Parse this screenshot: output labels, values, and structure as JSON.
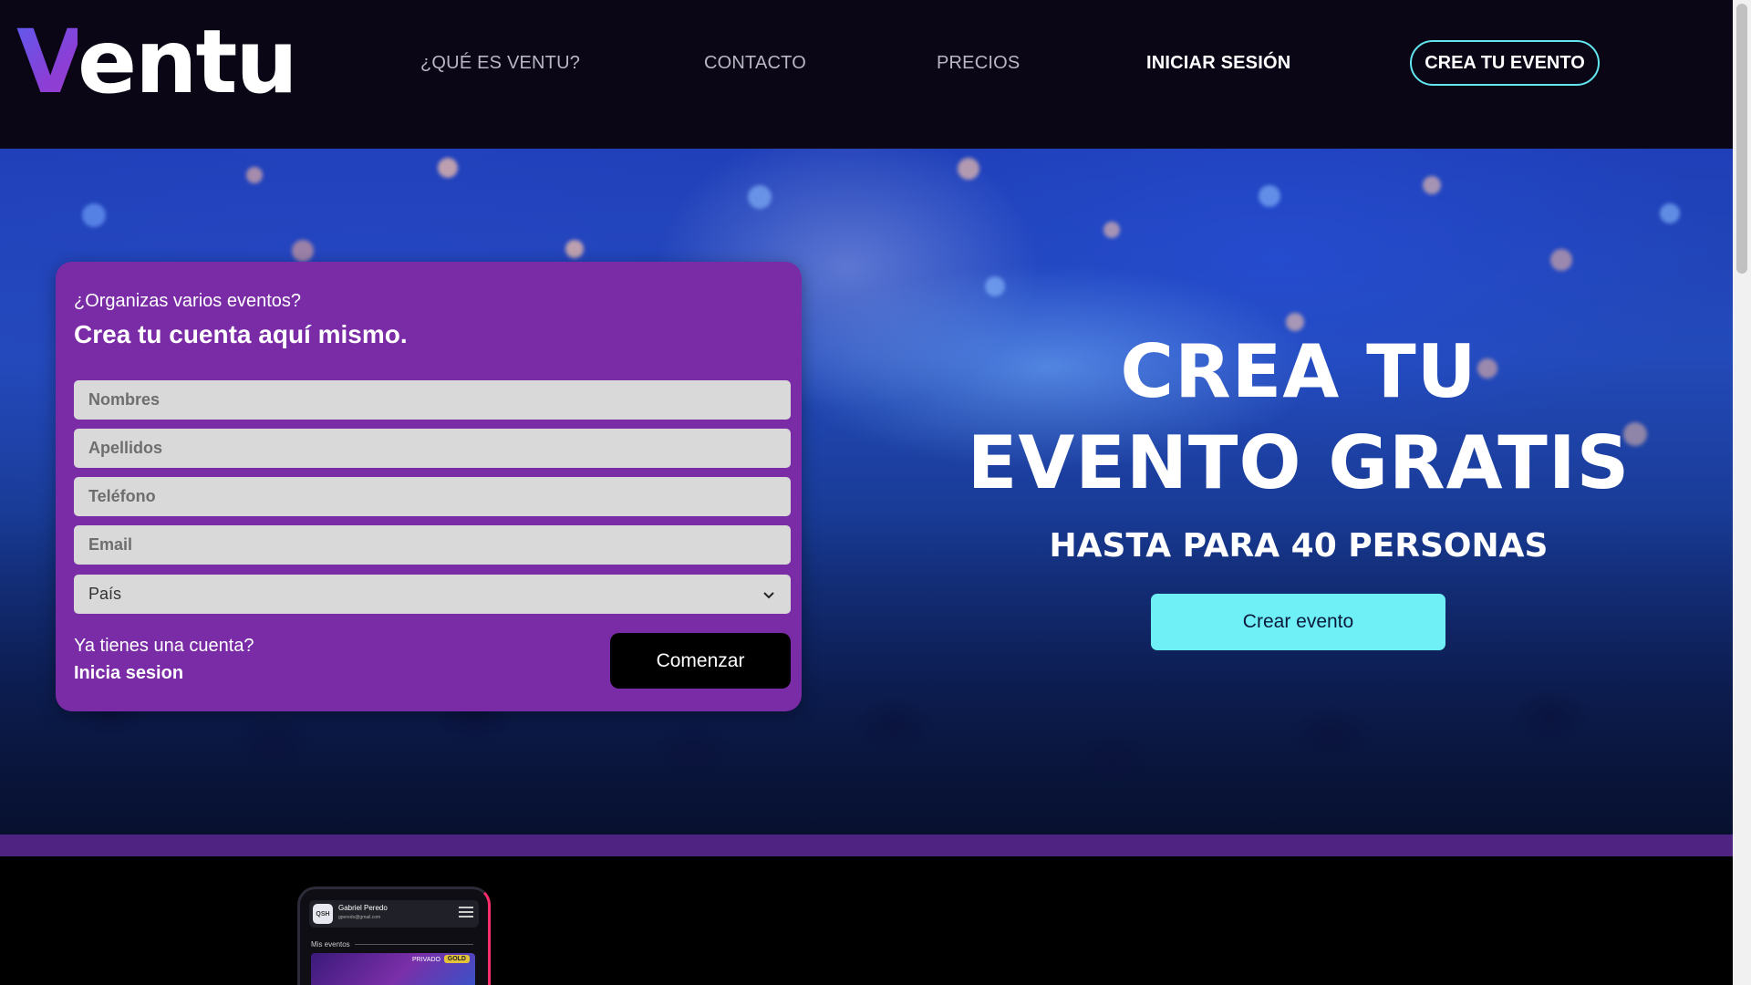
{
  "header": {
    "logo_v": "V",
    "logo_rest": "entu",
    "nav": {
      "what": "¿QUÉ ES VENTU?",
      "contact": "CONTACTO",
      "pricing": "PRECIOS",
      "login": "INICIAR SESIÓN"
    },
    "cta": "CREA TU EVENTO"
  },
  "signup": {
    "question": "¿Organizas varios eventos?",
    "heading": "Crea tu cuenta aquí mismo.",
    "fields": {
      "first_name": "Nombres",
      "last_name": "Apellidos",
      "phone": "Teléfono",
      "email": "Email"
    },
    "country_select": "País",
    "have_account": "Ya tienes una cuenta?",
    "login_link": "Inicia sesion",
    "submit": "Comenzar"
  },
  "hero": {
    "title_line1": "CREA TU",
    "title_line2": "EVENTO GRATIS",
    "subtitle": "HASTA PARA 40 PERSONAS",
    "button": "Crear evento"
  },
  "phone_preview": {
    "avatar": "QSH",
    "user_name": "Gabriel Peredo",
    "user_email": "gperedo@gmail.com",
    "section": "Mis eventos",
    "tag_private": "PRIVADO",
    "tag_gold": "GOLD"
  },
  "colors": {
    "header_bg": "#0a0616",
    "accent_cyan": "#6ff0f6",
    "card_purple": "#7a2ba6",
    "band_purple": "#4e2382"
  },
  "icons": {
    "select": "chevron-down-icon",
    "phone_menu": "hamburger-menu-icon"
  }
}
